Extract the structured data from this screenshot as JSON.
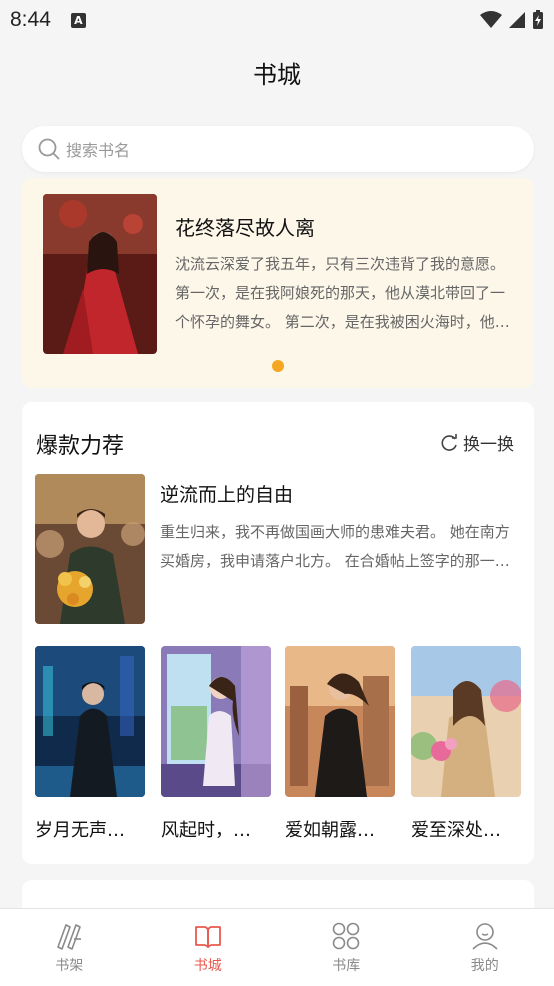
{
  "status_bar": {
    "time": "8:44",
    "notif_letter": "A"
  },
  "header": {
    "title": "书城"
  },
  "search": {
    "placeholder": "搜索书名"
  },
  "banner": {
    "title": "花终落尽故人离",
    "description": "沈流云深爱了我五年，只有三次违背了我的意愿。 第一次，是在我阿娘死的那天，他从漠北带回了一个怀孕的舞女。 第二次，是在我被困火海时，他选择先救她。"
  },
  "section": {
    "title": "爆款力荐",
    "refresh_label": "换一换",
    "featured": {
      "title": "逆流而上的自由",
      "description": "重生归来，我不再做国画大师的患难夫君。 她在南方买婚房，我申请落户北方。 在合婚帖上签字的那一刻。"
    },
    "books": [
      {
        "title": "岁月无声…"
      },
      {
        "title": "风起时，…"
      },
      {
        "title": "爱如朝露…"
      },
      {
        "title": "爱至深处…"
      }
    ]
  },
  "tabbar": {
    "tabs": [
      {
        "label": "书架",
        "icon": "bookshelf-icon"
      },
      {
        "label": "书城",
        "icon": "book-open-icon"
      },
      {
        "label": "书库",
        "icon": "grid-icon"
      },
      {
        "label": "我的",
        "icon": "profile-icon"
      }
    ]
  },
  "colors": {
    "accent": "#e85a4f",
    "dot": "#f5a623",
    "banner_bg": "#fdf7ea"
  }
}
